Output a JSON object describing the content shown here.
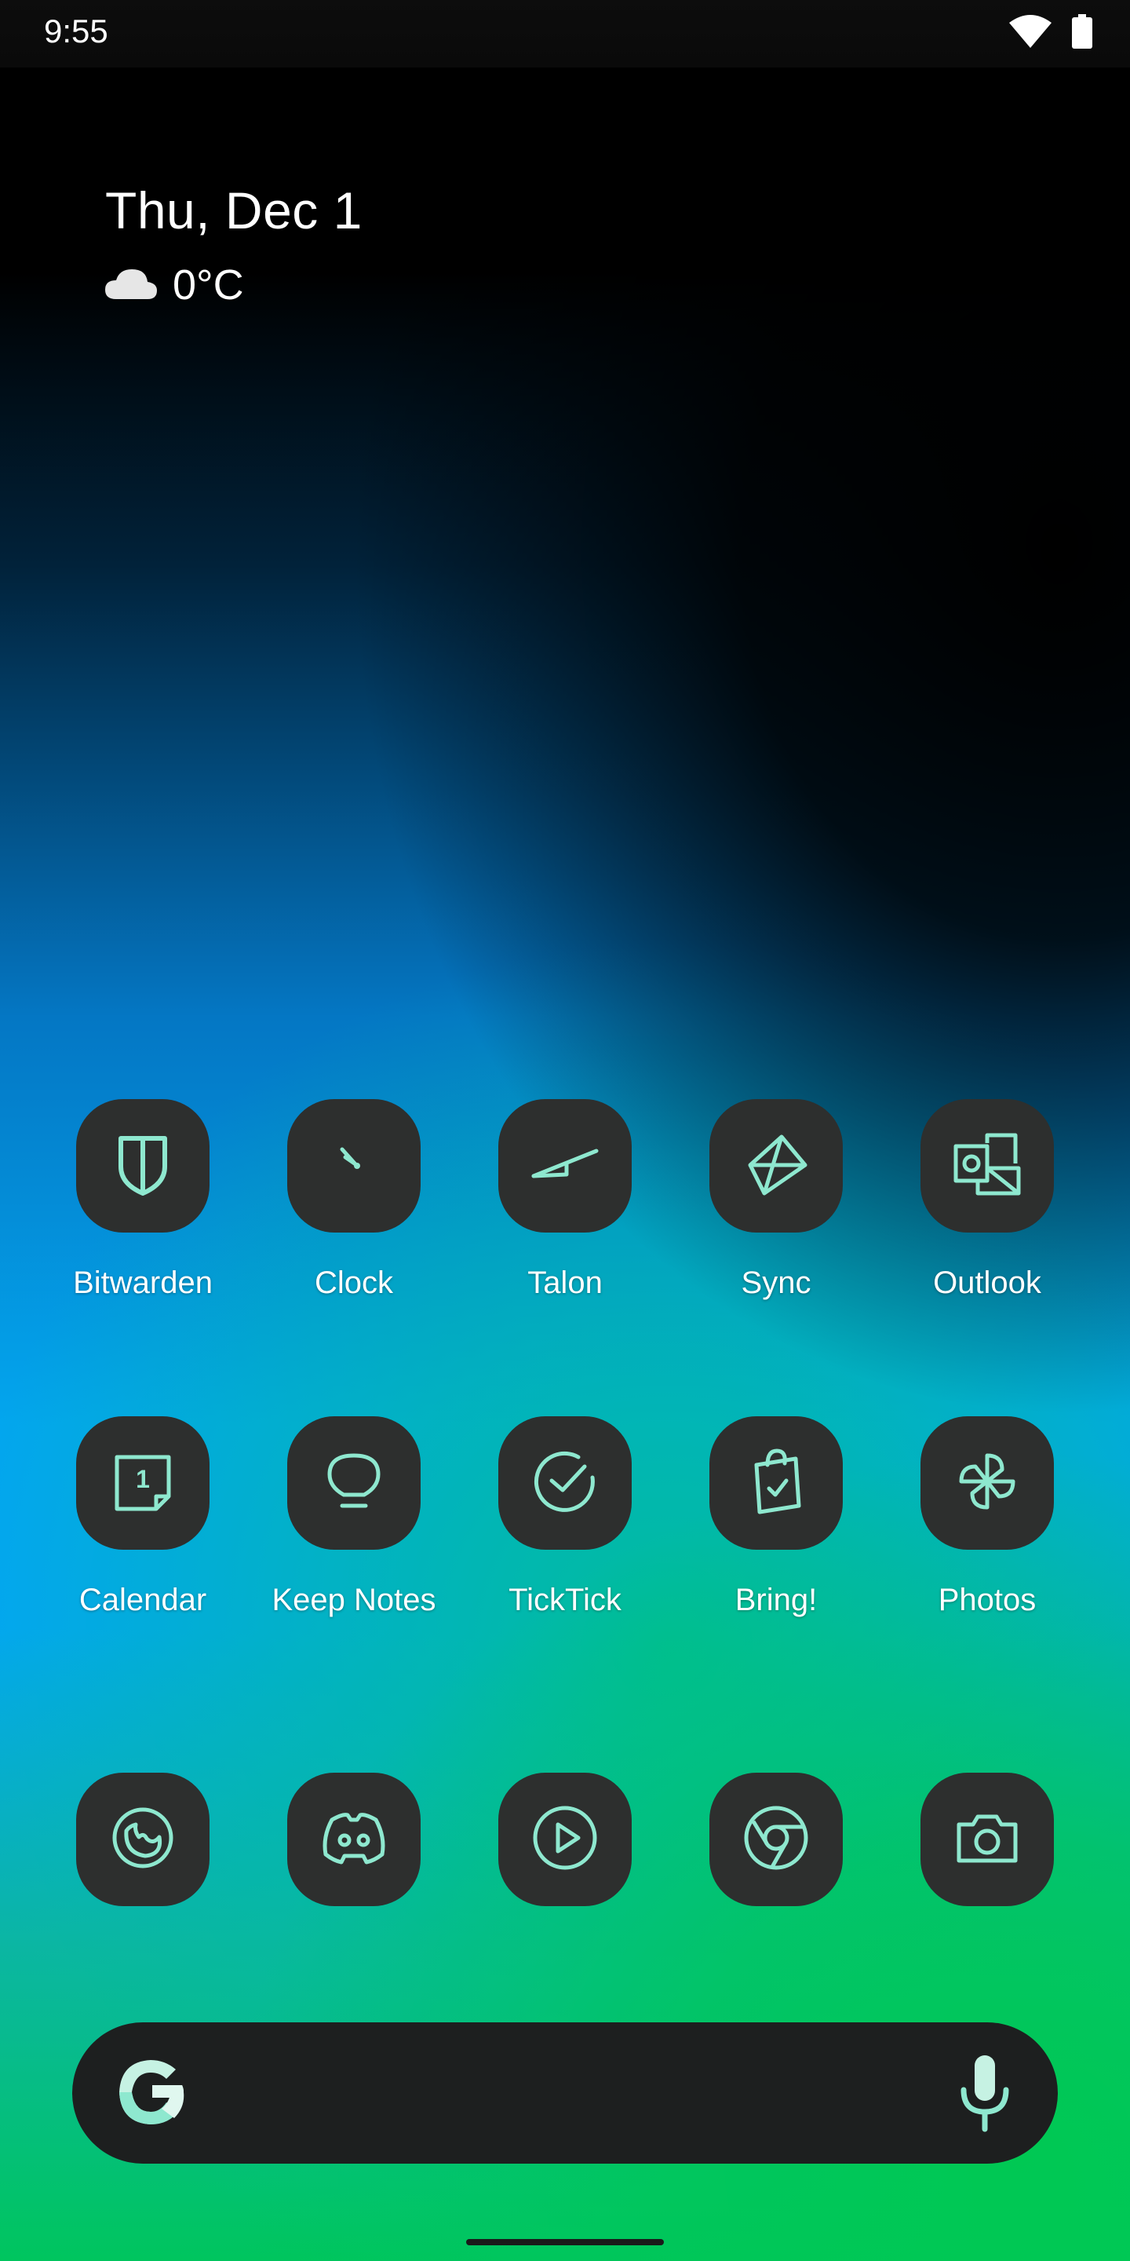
{
  "status_bar": {
    "time": "9:55",
    "icons": [
      "wifi-icon",
      "battery-icon"
    ]
  },
  "at_a_glance": {
    "date": "Thu, Dec 1",
    "temperature": "0°C",
    "weather_icon": "cloud-icon"
  },
  "apps_row1": [
    {
      "label": "Bitwarden",
      "icon": "bitwarden-shield-icon"
    },
    {
      "label": "Clock",
      "icon": "clock-icon"
    },
    {
      "label": "Talon",
      "icon": "talon-icon"
    },
    {
      "label": "Sync",
      "icon": "sync-icon"
    },
    {
      "label": "Outlook",
      "icon": "outlook-icon"
    }
  ],
  "apps_row2": [
    {
      "label": "Calendar",
      "icon": "calendar-icon",
      "day": "1"
    },
    {
      "label": "Keep Notes",
      "icon": "keep-notes-icon"
    },
    {
      "label": "TickTick",
      "icon": "ticktick-icon"
    },
    {
      "label": "Bring!",
      "icon": "bring-bag-icon"
    },
    {
      "label": "Photos",
      "icon": "photos-pinwheel-icon"
    }
  ],
  "dock": [
    {
      "icon": "firefox-icon"
    },
    {
      "icon": "discord-icon"
    },
    {
      "icon": "play-icon"
    },
    {
      "icon": "chrome-icon"
    },
    {
      "icon": "camera-icon"
    }
  ],
  "search_bar": {
    "icons": [
      "google-g-icon",
      "microphone-icon"
    ]
  },
  "colors": {
    "icon_accent": "#8ee8cf",
    "tile": "#2d2f2e",
    "search_bg": "#1d1f1f"
  }
}
